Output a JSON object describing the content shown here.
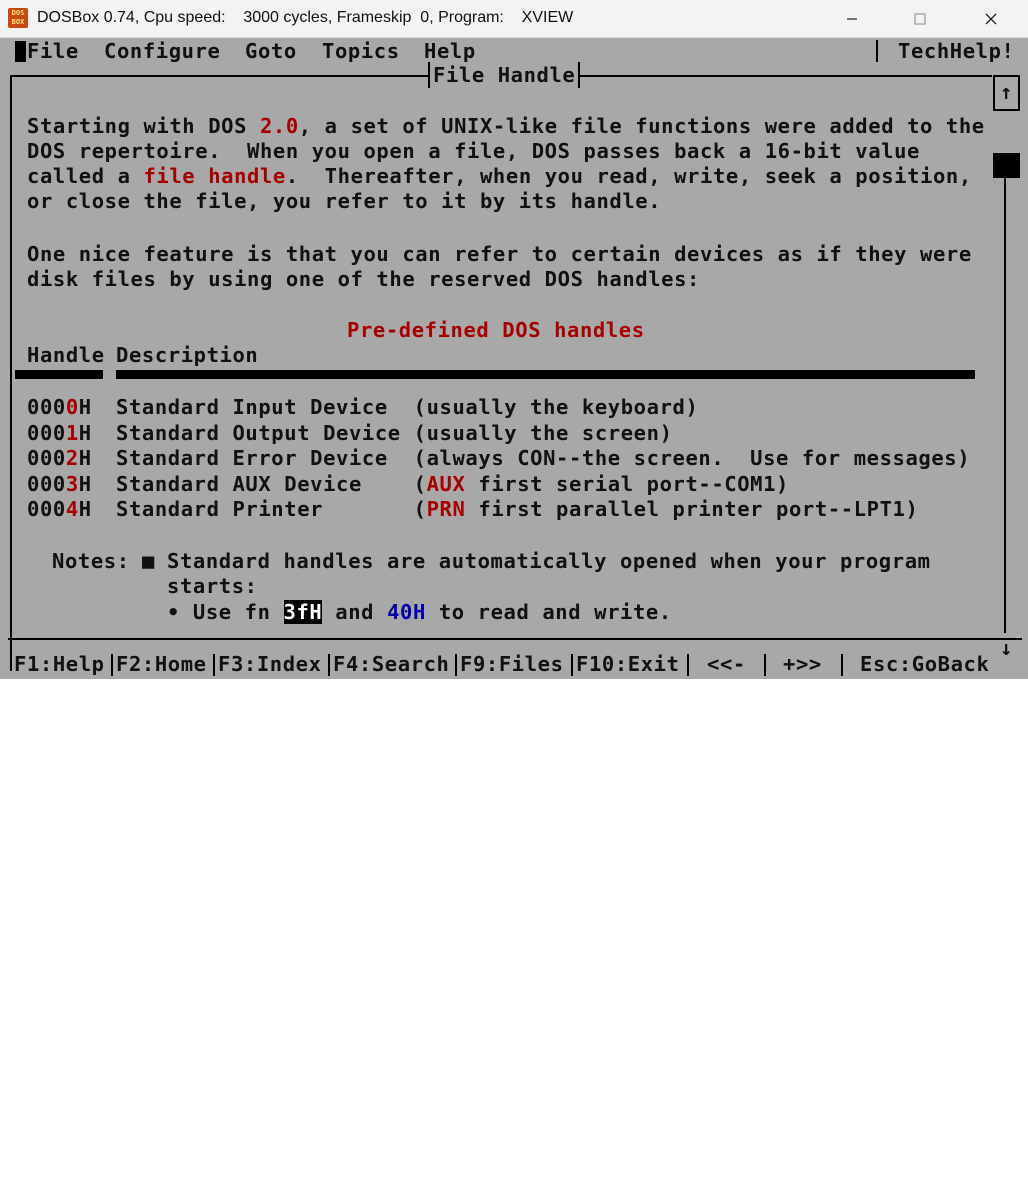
{
  "window": {
    "title": "DOSBox 0.74, Cpu speed:    3000 cycles, Frameskip  0, Program:    XVIEW",
    "icon_text": "DOS BOX"
  },
  "menu": {
    "items": [
      "File",
      "Configure",
      "Goto",
      "Topics",
      "Help"
    ],
    "right": "TechHelp!"
  },
  "topic": {
    "title": "File Handle"
  },
  "body": {
    "p1": [
      [
        "Starting with DOS ",
        {
          "t": "2.0",
          "c": "red"
        },
        ", a set of UNIX-like file functions were added to the"
      ],
      [
        "DOS repertoire.  When you open a file, DOS passes back a 16-bit value"
      ],
      [
        "called a ",
        {
          "t": "file handle",
          "c": "red"
        },
        ".  Thereafter, when you read, write, seek a position,"
      ],
      [
        "or close the file, you refer to it by its handle."
      ]
    ],
    "p2": [
      "One nice feature is that you can refer to certain devices as if they were",
      "disk files by using one of the reserved DOS handles:"
    ],
    "table_title": "Pre-defined DOS handles",
    "headers": [
      "Handle",
      "Description"
    ],
    "rows": [
      {
        "prefix": "000",
        "digit": "0",
        "suffix": "H",
        "desc": "Standard Input Device  (usually the keyboard)"
      },
      {
        "prefix": "000",
        "digit": "1",
        "suffix": "H",
        "desc": "Standard Output Device (usually the screen)"
      },
      {
        "prefix": "000",
        "digit": "2",
        "suffix": "H",
        "desc": "Standard Error Device  (always CON--the screen.  Use for messages)"
      },
      {
        "prefix": "000",
        "digit": "3",
        "suffix": "H",
        "desc_pre": "Standard AUX Device    (",
        "desc_hl": "AUX",
        "desc_post": " first serial port--COM1)"
      },
      {
        "prefix": "000",
        "digit": "4",
        "suffix": "H",
        "desc_pre": "Standard Printer       (",
        "desc_hl": "PRN",
        "desc_post": " first parallel printer port--LPT1)"
      }
    ],
    "notes": {
      "label": "Notes: ",
      "bullet1_marker": "■",
      "bullet1_line1": "Standard handles are automatically opened when your program",
      "bullet1_line2": "starts:",
      "bullet2_marker": "•",
      "bullet2_pre": "Use fn ",
      "bullet2_fn1": "3fH",
      "bullet2_mid": " and ",
      "bullet2_fn2": "40H",
      "bullet2_post": " to read and write."
    }
  },
  "scroll": {
    "up": "↑",
    "down": "↓",
    "position": 0.0
  },
  "footer": {
    "keys": [
      "F1:Help",
      "F2:Home",
      "F3:Index",
      "F4:Search",
      "F9:Files",
      "F10:Exit",
      "<<-",
      "+>>",
      "Esc:GoBack"
    ]
  },
  "colors": {
    "red": "#a80000",
    "blue": "#0000a8",
    "screen_bg": "#a8a8a8"
  }
}
